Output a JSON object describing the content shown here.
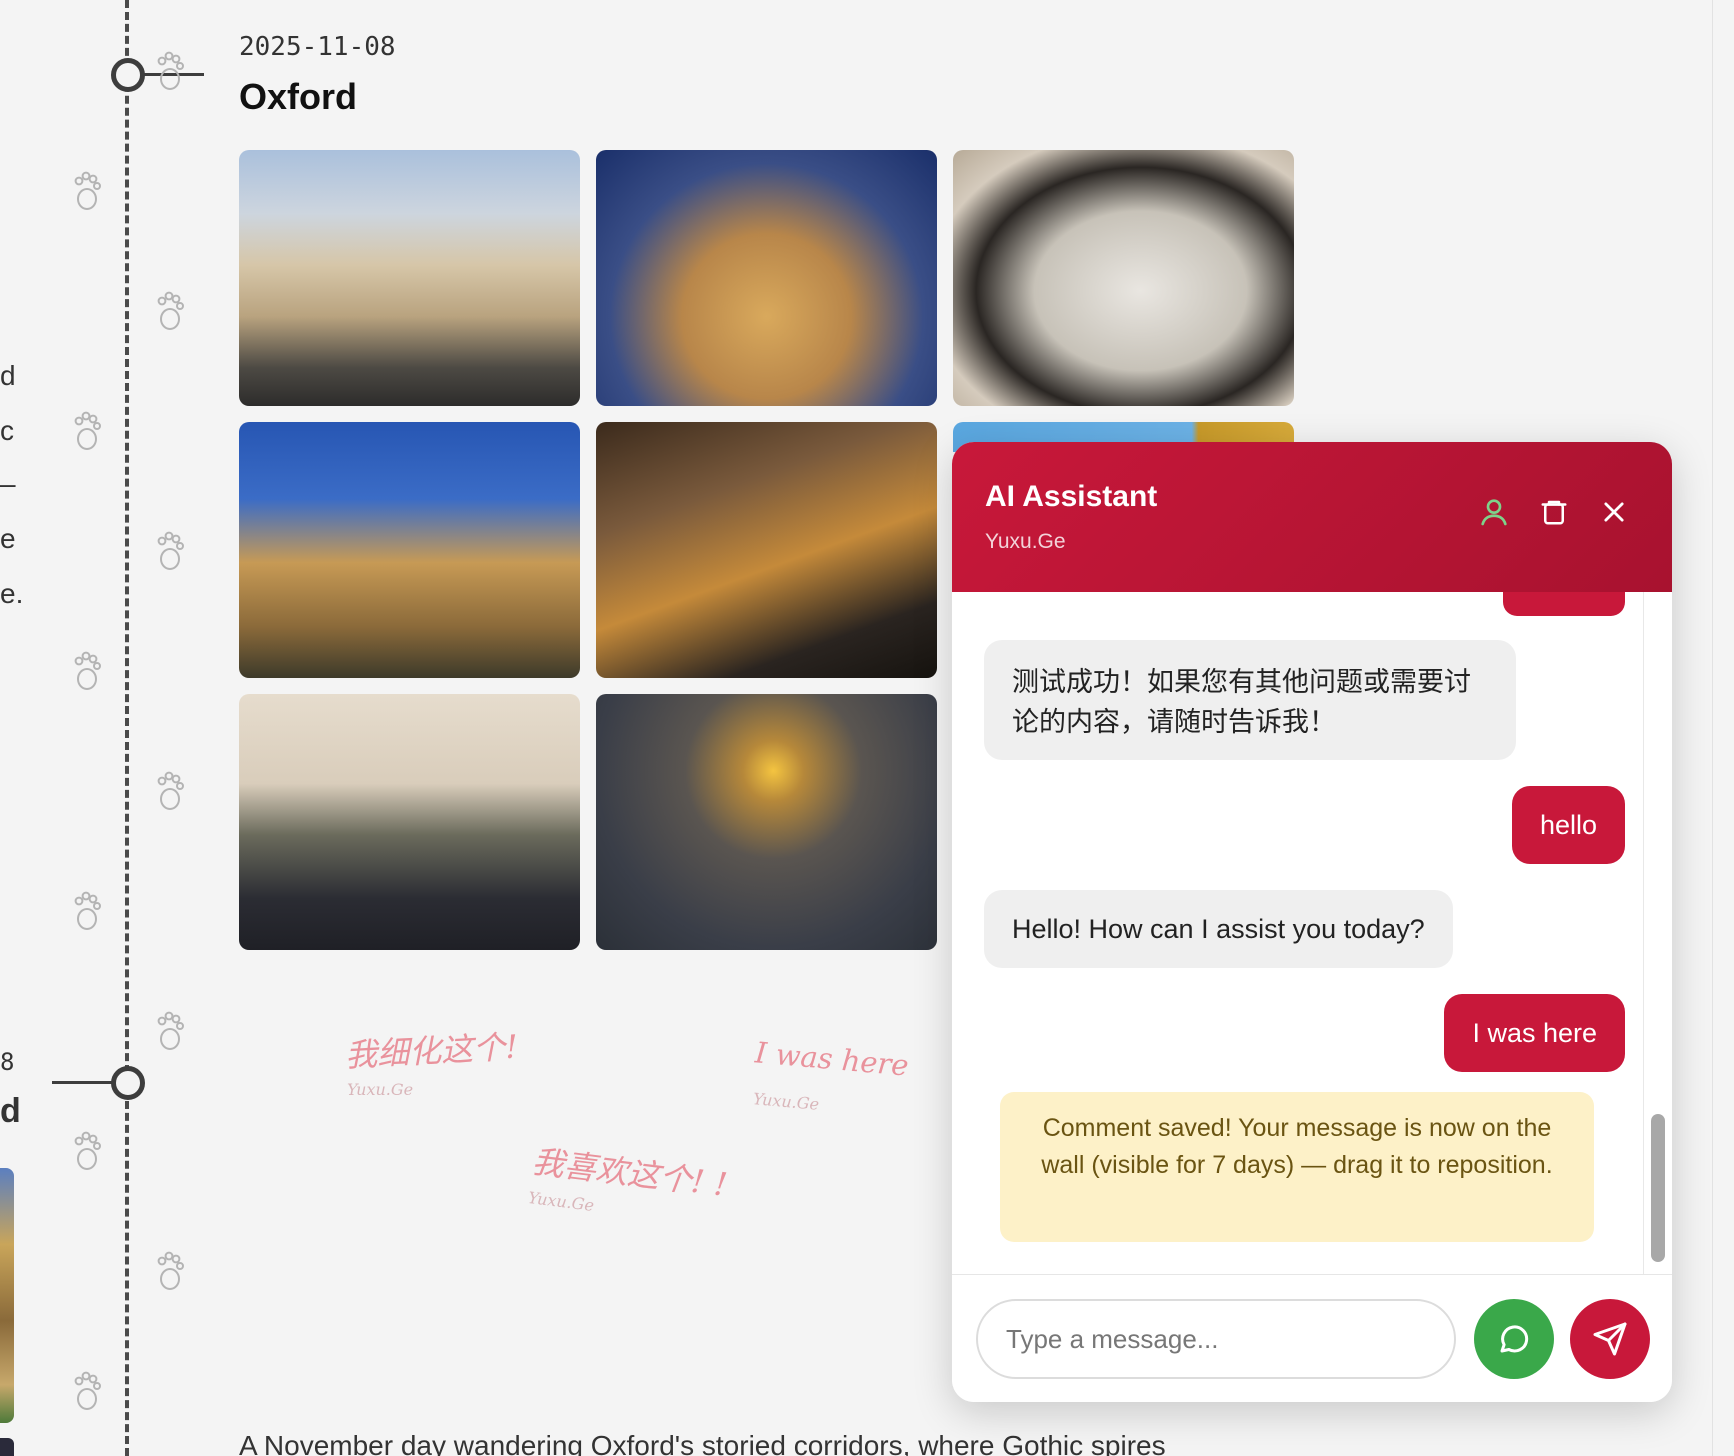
{
  "entry": {
    "date": "2025-11-08",
    "place": "Oxford",
    "paragraph": "A November day wandering Oxford's storied corridors, where Gothic spires"
  },
  "left_edge": [
    "d",
    "c",
    "–",
    "e",
    "e.",
    "8",
    "d"
  ],
  "wall_notes": [
    {
      "text": "我细化这个!",
      "signature": "Yuxu.Ge"
    },
    {
      "text": "I was here",
      "signature": "Yuxu.Ge"
    },
    {
      "text": "我喜欢这个! !",
      "signature": "Yuxu.Ge"
    }
  ],
  "chat": {
    "title": "AI Assistant",
    "subtitle": "Yuxu.Ge",
    "icons": {
      "profile": "user-icon",
      "clear": "trash-icon",
      "close": "close-icon",
      "comment": "chat-bubble-icon",
      "send": "send-icon"
    },
    "messages": [
      {
        "role": "bot",
        "text": "测试成功！如果您有其他问题或需要讨论的内容，请随时告诉我！",
        "line1": "测试成功！如果您有其他问题或需要讨",
        "line2": "论的内容，请随时告诉我！"
      },
      {
        "role": "user",
        "text": "hello"
      },
      {
        "role": "bot",
        "text": "Hello! How can I assist you today?"
      },
      {
        "role": "user",
        "text": "I was here"
      }
    ],
    "system_notice": "Comment saved! Your message is now on the wall (visible for 7 days) — drag it to reposition.",
    "input_placeholder": "Type a message...",
    "colors": {
      "accent": "#c8183a",
      "comment_button": "#3aa84a",
      "notice_bg": "#fdf1c8"
    }
  }
}
